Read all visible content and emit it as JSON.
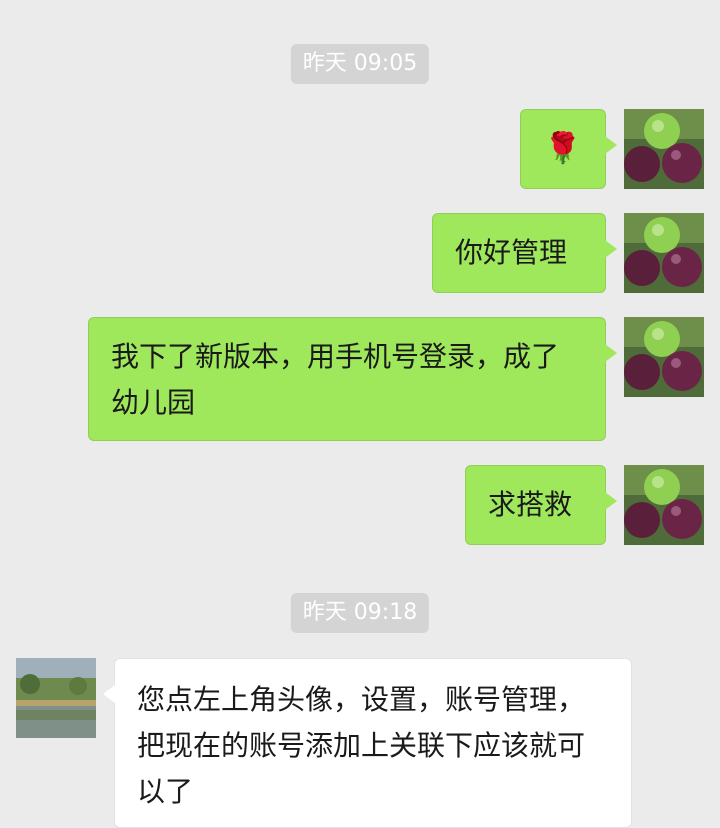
{
  "messages": [
    {
      "timestamp": "昨天 09:05"
    },
    {
      "text": "🌹"
    },
    {
      "text": "你好管理"
    },
    {
      "text": "我下了新版本，用手机号登录，成了幼儿园"
    },
    {
      "text": "求搭救"
    },
    {
      "timestamp": "昨天 09:18"
    },
    {
      "text": "您点左上角头像，设置，账号管理，把现在的账号添加上关联下应该就可以了"
    }
  ],
  "colors": {
    "background": "#ebebeb",
    "outgoing_bubble": "#9fe85c",
    "incoming_bubble": "#ffffff",
    "timestamp_bg": "#d4d4d4"
  },
  "icons": {
    "my_avatar": "fig-fruit-avatar-icon",
    "contact_avatar": "lake-landscape-avatar-icon"
  }
}
